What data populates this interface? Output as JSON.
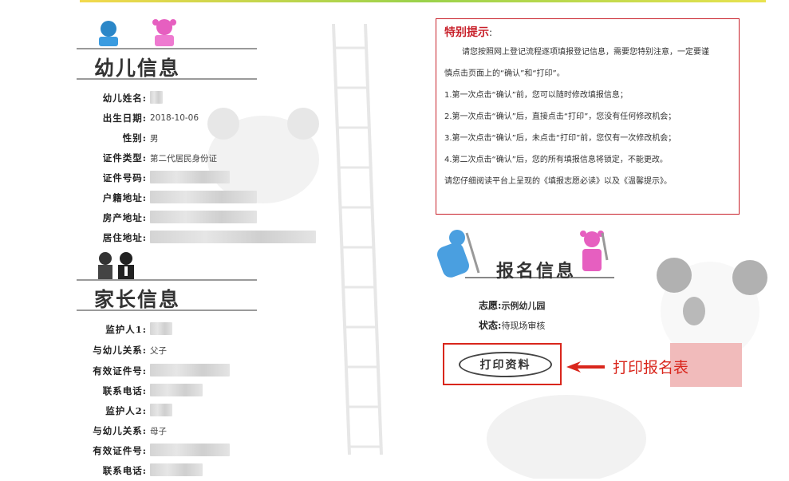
{
  "child_section": {
    "title": "幼儿信息",
    "fields": [
      {
        "label": "幼儿姓名:",
        "value": ""
      },
      {
        "label": "出生日期:",
        "value": "2018-10-06"
      },
      {
        "label": "性别:",
        "value": "男"
      },
      {
        "label": "证件类型:",
        "value": "第二代居民身份证"
      },
      {
        "label": "证件号码:",
        "value": ""
      },
      {
        "label": "户籍地址:",
        "value": ""
      },
      {
        "label": "房产地址:",
        "value": ""
      },
      {
        "label": "居住地址:",
        "value": ""
      }
    ]
  },
  "parent_section": {
    "title": "家长信息",
    "fields": [
      {
        "label": "监护人1:",
        "value": ""
      },
      {
        "label": "与幼儿关系:",
        "value": "父子"
      },
      {
        "label": "有效证件号:",
        "value": ""
      },
      {
        "label": "联系电话:",
        "value": ""
      },
      {
        "label": "监护人2:",
        "value": ""
      },
      {
        "label": "与幼儿关系:",
        "value": "母子"
      },
      {
        "label": "有效证件号:",
        "value": ""
      },
      {
        "label": "联系电话:",
        "value": ""
      }
    ]
  },
  "notice": {
    "title": "特别提示",
    "colon": ":",
    "lines": [
      "请您按照网上登记流程逐项填报登记信息，需要您特别注意，一定要谨",
      "慎点击页面上的“确认”和“打印”。",
      "1.第一次点击“确认”前，您可以随时修改填报信息；",
      "2.第一次点击“确认”后，直接点击“打印”，您没有任何修改机会；",
      "3.第一次点击“确认”后，未点击“打印”前，您仅有一次修改机会；",
      "4.第二次点击“确认”后，您的所有填报信息将锁定，不能更改。",
      "请您仔细阅读平台上呈现的《填报志愿必读》以及《温馨提示》。"
    ]
  },
  "registration": {
    "title": "报名信息",
    "wish_label": "志愿:",
    "wish_value": "示例幼儿园",
    "status_label": "状态:",
    "status_value": "待现场审核",
    "print_button": "打印资料",
    "annotation": "打印报名表"
  },
  "colors": {
    "accent_red": "#d9261c",
    "notice_border": "#c8202a"
  }
}
